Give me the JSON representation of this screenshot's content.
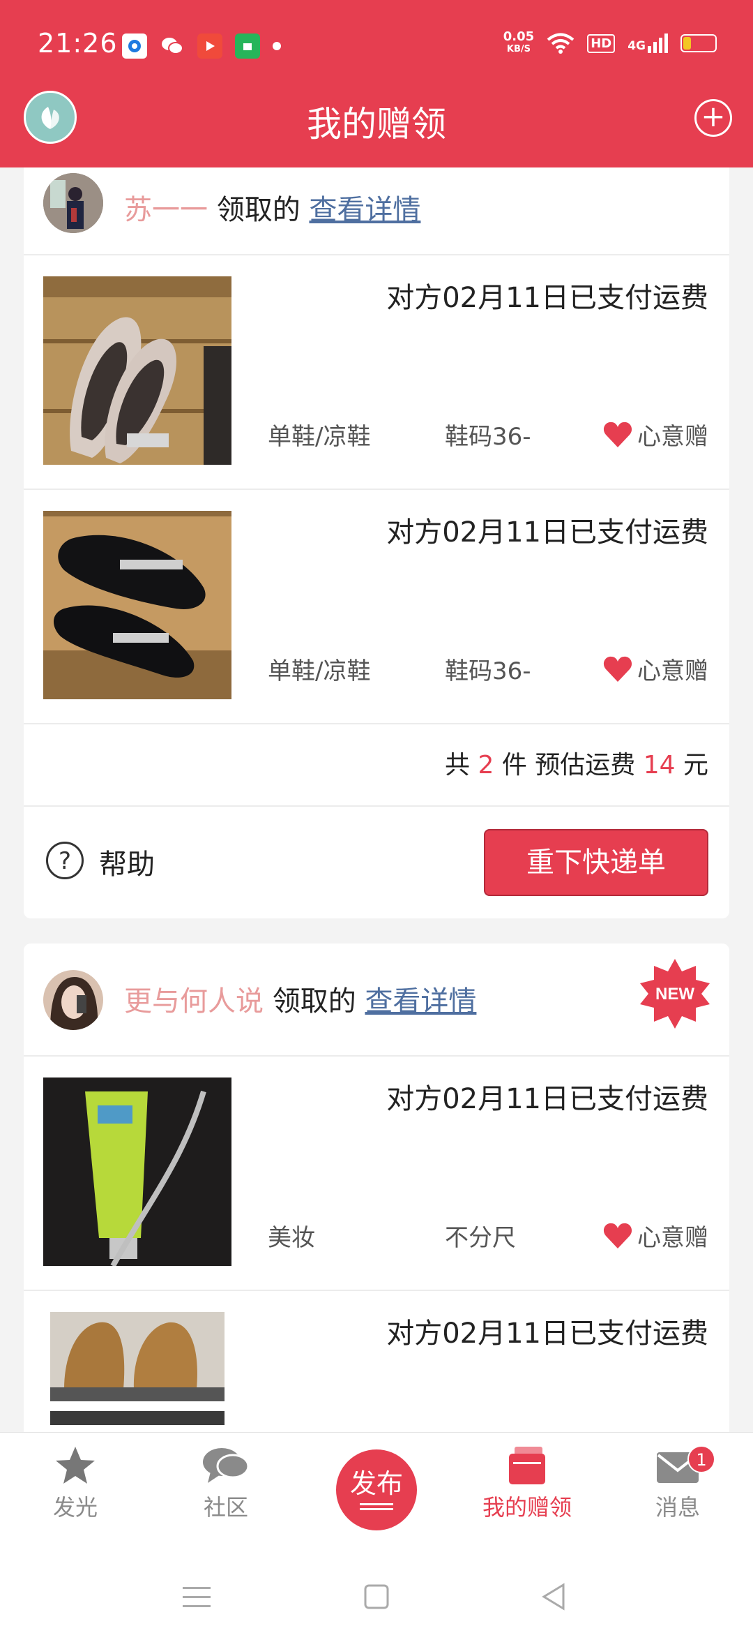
{
  "status_bar": {
    "time": "21:26",
    "net_speed_value": "0.05",
    "net_speed_unit": "KB/S",
    "hd": "HD",
    "network": "4G",
    "battery": "14"
  },
  "header": {
    "title": "我的赠领"
  },
  "orders": [
    {
      "owner_name": "苏一一",
      "owner_action": "领取的",
      "detail_link": "查看详情",
      "items": [
        {
          "status": "对方02月11日已支付运费",
          "category": "单鞋/凉鞋",
          "size": "鞋码36-",
          "tag": "心意赠"
        },
        {
          "status": "对方02月11日已支付运费",
          "category": "单鞋/凉鞋",
          "size": "鞋码36-",
          "tag": "心意赠"
        }
      ],
      "summary": {
        "prefix": "共",
        "count": "2",
        "middle": "件 预估运费",
        "fee": "14",
        "suffix": "元"
      },
      "help_label": "帮助",
      "reorder_label": "重下快递单"
    },
    {
      "owner_name": "更与何人说",
      "owner_action": "领取的",
      "detail_link": "查看详情",
      "new_badge": "NEW",
      "items": [
        {
          "status": "对方02月11日已支付运费",
          "category": "美妆",
          "size": "不分尺",
          "tag": "心意赠"
        },
        {
          "status": "对方02月11日已支付运费"
        }
      ]
    }
  ],
  "tabbar": {
    "tabs": [
      {
        "label": "发光",
        "icon": "star-icon"
      },
      {
        "label": "社区",
        "icon": "chat-bubble-icon"
      },
      {
        "label": "我的赠领",
        "icon": "wallet-icon"
      },
      {
        "label": "消息",
        "icon": "mail-icon",
        "badge": "1"
      }
    ],
    "publish_label": "发布"
  },
  "colors": {
    "accent": "#e63e50",
    "owner_name": "#e89b9b",
    "link": "#4f6fa0"
  }
}
